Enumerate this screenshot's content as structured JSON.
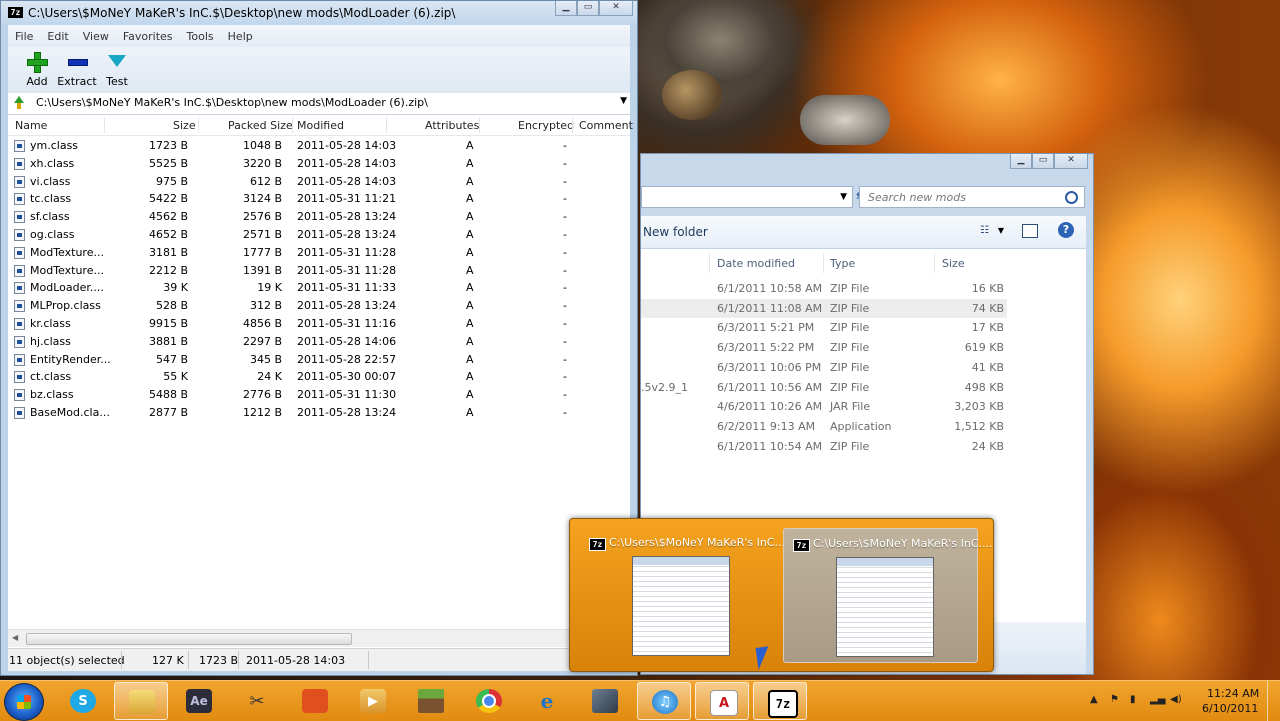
{
  "zip_window": {
    "title": "C:\\Users\\$MoNeY MaKeR's InC.$\\Desktop\\new  mods\\ModLoader (6).zip\\",
    "app_icon_label": "7z",
    "menu": [
      "File",
      "Edit",
      "View",
      "Favorites",
      "Tools",
      "Help"
    ],
    "toolbar": {
      "add_label": "Add",
      "extract_label": "Extract",
      "test_label": "Test"
    },
    "address_path": "C:\\Users\\$MoNeY MaKeR's InC.$\\Desktop\\new  mods\\ModLoader (6).zip\\",
    "columns": [
      "Name",
      "Size",
      "Packed Size",
      "Modified",
      "Attributes",
      "Encrypted",
      "Comment"
    ],
    "files": [
      {
        "name": "ym.class",
        "size": "1723 B",
        "packed": "1048 B",
        "modified": "2011-05-28 14:03",
        "attr": "A",
        "enc": "-"
      },
      {
        "name": "xh.class",
        "size": "5525 B",
        "packed": "3220 B",
        "modified": "2011-05-28 14:03",
        "attr": "A",
        "enc": "-"
      },
      {
        "name": "vi.class",
        "size": "975 B",
        "packed": "612 B",
        "modified": "2011-05-28 14:03",
        "attr": "A",
        "enc": "-"
      },
      {
        "name": "tc.class",
        "size": "5422 B",
        "packed": "3124 B",
        "modified": "2011-05-31 11:21",
        "attr": "A",
        "enc": "-"
      },
      {
        "name": "sf.class",
        "size": "4562 B",
        "packed": "2576 B",
        "modified": "2011-05-28 13:24",
        "attr": "A",
        "enc": "-"
      },
      {
        "name": "og.class",
        "size": "4652 B",
        "packed": "2571 B",
        "modified": "2011-05-28 13:24",
        "attr": "A",
        "enc": "-"
      },
      {
        "name": "ModTexture...",
        "size": "3181 B",
        "packed": "1777 B",
        "modified": "2011-05-31 11:28",
        "attr": "A",
        "enc": "-"
      },
      {
        "name": "ModTexture...",
        "size": "2212 B",
        "packed": "1391 B",
        "modified": "2011-05-31 11:28",
        "attr": "A",
        "enc": "-"
      },
      {
        "name": "ModLoader....",
        "size": "39 K",
        "packed": "19 K",
        "modified": "2011-05-31 11:33",
        "attr": "A",
        "enc": "-"
      },
      {
        "name": "MLProp.class",
        "size": "528 B",
        "packed": "312 B",
        "modified": "2011-05-28 13:24",
        "attr": "A",
        "enc": "-"
      },
      {
        "name": "kr.class",
        "size": "9915 B",
        "packed": "4856 B",
        "modified": "2011-05-31 11:16",
        "attr": "A",
        "enc": "-"
      },
      {
        "name": "hj.class",
        "size": "3881 B",
        "packed": "2297 B",
        "modified": "2011-05-28 14:06",
        "attr": "A",
        "enc": "-"
      },
      {
        "name": "EntityRender...",
        "size": "547 B",
        "packed": "345 B",
        "modified": "2011-05-28 22:57",
        "attr": "A",
        "enc": "-"
      },
      {
        "name": "ct.class",
        "size": "55 K",
        "packed": "24 K",
        "modified": "2011-05-30 00:07",
        "attr": "A",
        "enc": "-"
      },
      {
        "name": "bz.class",
        "size": "5488 B",
        "packed": "2776 B",
        "modified": "2011-05-31 11:30",
        "attr": "A",
        "enc": "-"
      },
      {
        "name": "BaseMod.cla...",
        "size": "2877 B",
        "packed": "1212 B",
        "modified": "2011-05-28 13:24",
        "attr": "A",
        "enc": "-"
      }
    ],
    "status": {
      "selected": "11 object(s) selected",
      "total": "127 K",
      "size": "1723 B",
      "date": "2011-05-28 14:03"
    }
  },
  "explorer_window": {
    "search_placeholder": "Search new  mods",
    "new_folder_label": "New folder",
    "help_label": "?",
    "columns": [
      "Date modified",
      "Type",
      "Size"
    ],
    "files": [
      {
        "name": "",
        "date": "6/1/2011 10:58 AM",
        "type": "ZIP File",
        "size": "16 KB"
      },
      {
        "name": "",
        "date": "6/1/2011 11:08 AM",
        "type": "ZIP File",
        "size": "74 KB"
      },
      {
        "name": "",
        "date": "6/3/2011 5:21 PM",
        "type": "ZIP File",
        "size": "17 KB"
      },
      {
        "name": "",
        "date": "6/3/2011 5:22 PM",
        "type": "ZIP File",
        "size": "619 KB"
      },
      {
        "name": "",
        "date": "6/3/2011 10:06 PM",
        "type": "ZIP File",
        "size": "41 KB"
      },
      {
        "name": ".5v2.9_1",
        "date": "6/1/2011 10:56 AM",
        "type": "ZIP File",
        "size": "498 KB"
      },
      {
        "name": "",
        "date": "4/6/2011 10:26 AM",
        "type": "JAR File",
        "size": "3,203 KB"
      },
      {
        "name": "",
        "date": "6/2/2011 9:13 AM",
        "type": "Application",
        "size": "1,512 KB"
      },
      {
        "name": "",
        "date": "6/1/2011 10:54 AM",
        "type": "ZIP File",
        "size": "24 KB"
      }
    ]
  },
  "flyout": {
    "thumb1_title": "C:\\Users\\$MoNeY MaKeR's InC....",
    "thumb2_title": "C:\\Users\\$MoNeY MaKeR's InC...."
  },
  "taskbar": {
    "ae_label": "Ae",
    "sevenzip_label": "7z",
    "adobe_label": "A",
    "time": "11:24 AM",
    "date": "6/10/2011"
  }
}
